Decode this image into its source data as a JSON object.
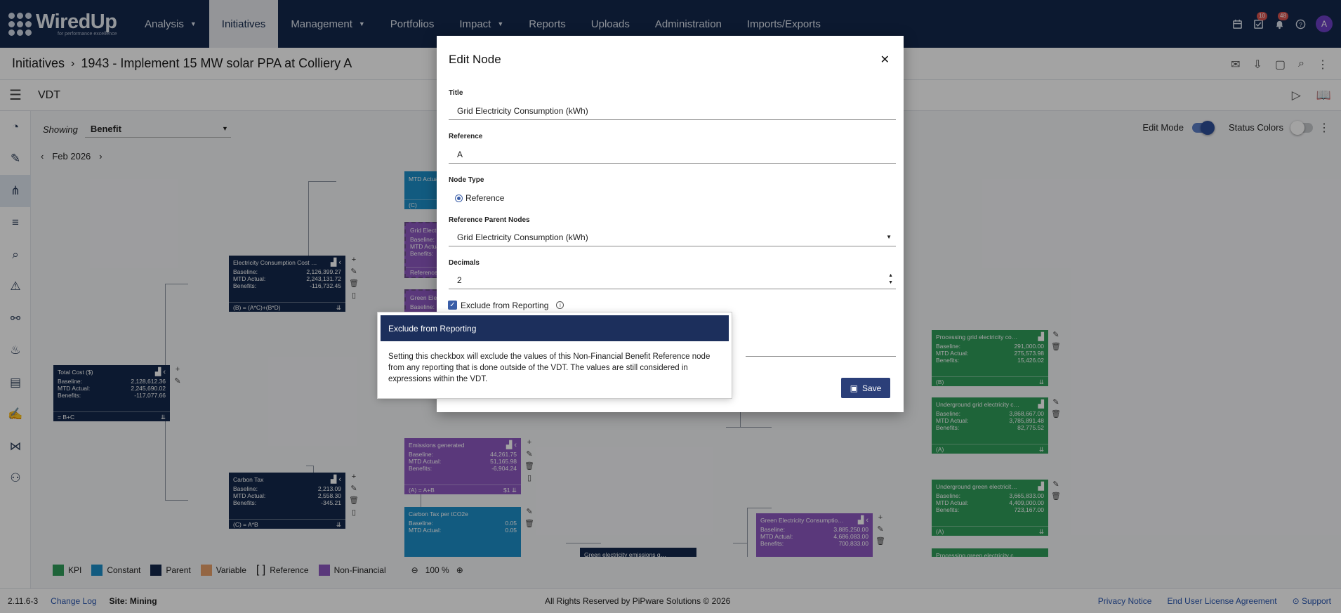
{
  "logo": {
    "name": "WiredUp",
    "tagline": "for performance excellence"
  },
  "nav": [
    {
      "label": "Analysis",
      "dropdown": true,
      "active": false
    },
    {
      "label": "Initiatives",
      "dropdown": false,
      "active": true
    },
    {
      "label": "Management",
      "dropdown": true,
      "active": false
    },
    {
      "label": "Portfolios",
      "dropdown": false,
      "active": false
    },
    {
      "label": "Impact",
      "dropdown": true,
      "active": false
    },
    {
      "label": "Reports",
      "dropdown": false,
      "active": false
    },
    {
      "label": "Uploads",
      "dropdown": false,
      "active": false
    },
    {
      "label": "Administration",
      "dropdown": false,
      "active": false
    },
    {
      "label": "Imports/Exports",
      "dropdown": false,
      "active": false
    }
  ],
  "nav_right": {
    "tasks_badge": "10",
    "notifications_badge": "48",
    "avatar_initial": "A"
  },
  "breadcrumb": {
    "root": "Initiatives",
    "current": "1943 - Implement 15 MW solar PPA at Colliery A"
  },
  "vdt": {
    "title": "VDT"
  },
  "canvas": {
    "showing_label": "Showing",
    "showing_value": "Benefit",
    "period": "Feb 2026",
    "edit_mode_label": "Edit Mode",
    "edit_mode_on": true,
    "status_colors_label": "Status Colors",
    "status_colors_on": false
  },
  "nodes": {
    "total_cost": {
      "title": "Total Cost ($)",
      "baseline": "2,128,612.36",
      "mtd": "2,245,690.02",
      "benefits": "-117,077.66",
      "formula": "= B+C"
    },
    "elec_cost": {
      "title": "Electricity Consumption Cost ($)",
      "baseline": "2,126,399.27",
      "mtd": "2,243,131.72",
      "benefits": "-116,732.45",
      "formula": "(B) = (A*C)+(B*D)"
    },
    "carbon_tax": {
      "title": "Carbon Tax",
      "baseline": "2,213.09",
      "mtd": "2,558.30",
      "benefits": "-345.21",
      "formula": "(C) = A*B"
    },
    "emissions": {
      "title": "Emissions generated",
      "baseline": "44,261.75",
      "mtd": "51,165.98",
      "benefits": "-6,904.24",
      "formula": "(A) = A+B",
      "badge": "$1"
    },
    "carbon_tax_per": {
      "title": "Carbon Tax per tCO2e",
      "baseline": "0.05",
      "mtd": "0.05"
    },
    "processing_grid": {
      "title": "Processing grid electricity consump...",
      "baseline": "291,000.00",
      "mtd": "275,573.98",
      "benefits": "15,426.02",
      "formula": "(B)"
    },
    "underground_grid": {
      "title": "Underground grid electricity consu...",
      "baseline": "3,868,667.00",
      "mtd": "3,785,891.48",
      "benefits": "82,775.52",
      "formula": "(A)"
    },
    "underground_green": {
      "title": "Underground green electricity cons...",
      "baseline": "3,665,833.00",
      "mtd": "4,409,000.00",
      "benefits": "723,167.00",
      "formula": "(A)"
    },
    "green_elec": {
      "title": "Green Electricity Consumption (kWh)",
      "baseline": "3,885,250.00",
      "mtd": "4,686,083.00",
      "benefits": "700,833.00"
    },
    "green_emissions": {
      "title": "Green electricity emissions generat..."
    },
    "processing_green": {
      "title": "Processing green electricity consu..."
    },
    "constant_top": {
      "mtd_label": "MTD Actual:",
      "formula": "(C)"
    },
    "grid_elec_partial": {
      "title": "Grid Electr",
      "footer": "Reference"
    },
    "green_elec_partial": {
      "title": "Green Elec"
    },
    "field_labels": {
      "baseline": "Baseline:",
      "mtd": "MTD Actual:",
      "benefits": "Benefits:"
    }
  },
  "legend": [
    {
      "label": "KPI",
      "color": "#2f9d5a"
    },
    {
      "label": "Constant",
      "color": "#1d8fc8"
    },
    {
      "label": "Parent",
      "color": "#13284b"
    },
    {
      "label": "Variable",
      "color": "#e8a06a"
    },
    {
      "label": "Reference",
      "color": ""
    },
    {
      "label": "Non-Financial",
      "color": "#8d58c0"
    }
  ],
  "zoom": "100 %",
  "footer": {
    "version": "2.11.6-3",
    "changelog": "Change Log",
    "site": "Site: Mining",
    "copyright": "All Rights Reserved by PiPware Solutions © 2026",
    "privacy": "Privacy Notice",
    "eula": "End User License Agreement",
    "support": "Support"
  },
  "modal": {
    "title": "Edit Node",
    "title_label": "Title",
    "title_value": "Grid Electricity Consumption (kWh)",
    "reference_label": "Reference",
    "reference_value": "A",
    "node_type_label": "Node Type",
    "node_type_value": "Reference",
    "parent_nodes_label": "Reference Parent Nodes",
    "parent_nodes_value": "Grid Electricity Consumption (kWh)",
    "decimals_label": "Decimals",
    "decimals_value": "2",
    "exclude_label": "Exclude from Reporting",
    "exclude_checked": true,
    "save_label": "Save"
  },
  "popover": {
    "title": "Exclude from Reporting",
    "body": "Setting this checkbox will exclude the values of this Non-Financial Benefit Reference node from any reporting that is done outside of the VDT. The values are still considered in expressions within the VDT."
  }
}
